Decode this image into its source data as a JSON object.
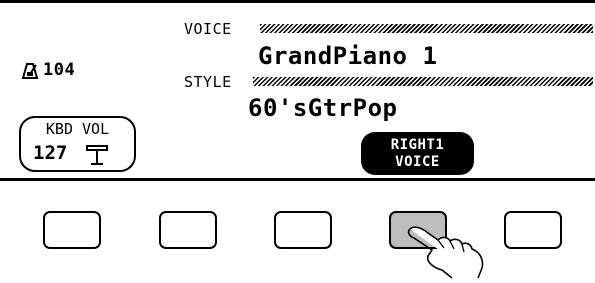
{
  "display": {
    "tempo": {
      "icon": "metronome-icon",
      "value": "104"
    },
    "voice": {
      "label": "VOICE",
      "name": "GrandPiano 1"
    },
    "style": {
      "label": "STYLE",
      "name": "60'sGtrPop"
    },
    "kbd_vol": {
      "label": "KBD VOL",
      "value": "127",
      "icon": "slider-icon"
    },
    "soft_button": {
      "line1": "RIGHT1",
      "line2": "VOICE"
    }
  },
  "panel": {
    "buttons": [
      {
        "name": "button-1",
        "pressed": false
      },
      {
        "name": "button-2",
        "pressed": false
      },
      {
        "name": "button-3",
        "pressed": false
      },
      {
        "name": "button-4",
        "pressed": true
      },
      {
        "name": "button-5",
        "pressed": false
      }
    ]
  },
  "colors": {
    "lcd_background": "#ffffff",
    "ink": "#000000",
    "pressed_button": "#bdbdbd"
  }
}
